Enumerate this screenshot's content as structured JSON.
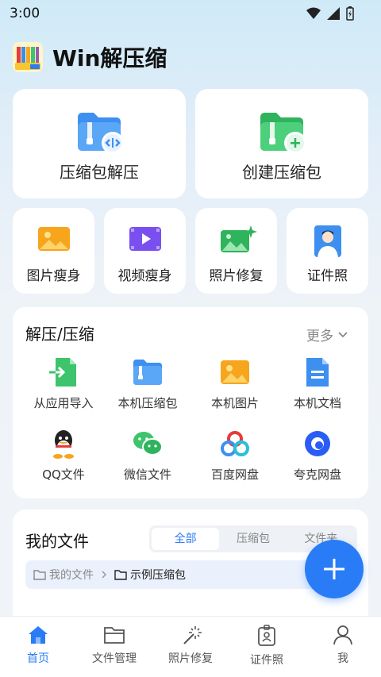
{
  "status": {
    "time": "3:00"
  },
  "app": {
    "title": "Win解压缩"
  },
  "big_cards": [
    {
      "label": "压缩包解压",
      "icon": "blue-zip-folder-icon"
    },
    {
      "label": "创建压缩包",
      "icon": "green-zip-folder-add-icon"
    }
  ],
  "small_cards": [
    {
      "label": "图片瘦身",
      "icon": "image-icon"
    },
    {
      "label": "视频瘦身",
      "icon": "video-icon"
    },
    {
      "label": "照片修复",
      "icon": "photo-sparkle-icon"
    },
    {
      "label": "证件照",
      "icon": "id-photo-icon"
    }
  ],
  "compress_section": {
    "title": "解压/压缩",
    "more": "更多",
    "items": [
      {
        "label": "从应用导入",
        "icon": "import-app-icon"
      },
      {
        "label": "本机压缩包",
        "icon": "local-zip-icon"
      },
      {
        "label": "本机图片",
        "icon": "local-image-icon"
      },
      {
        "label": "本机文档",
        "icon": "local-doc-icon"
      },
      {
        "label": "QQ文件",
        "icon": "qq-icon"
      },
      {
        "label": "微信文件",
        "icon": "wechat-icon"
      },
      {
        "label": "百度网盘",
        "icon": "baidu-netdisk-icon"
      },
      {
        "label": "夸克网盘",
        "icon": "quark-netdisk-icon"
      }
    ]
  },
  "files_section": {
    "title": "我的文件",
    "tabs": [
      "全部",
      "压缩包",
      "文件夹"
    ],
    "active_tab": "全部",
    "breadcrumb": [
      "我的文件",
      "示例压缩包"
    ]
  },
  "tabbar": [
    {
      "label": "首页",
      "icon": "home-icon",
      "active": true
    },
    {
      "label": "文件管理",
      "icon": "folder-icon",
      "active": false
    },
    {
      "label": "照片修复",
      "icon": "magic-wand-icon",
      "active": false
    },
    {
      "label": "证件照",
      "icon": "badge-icon",
      "active": false
    },
    {
      "label": "我",
      "icon": "user-icon",
      "active": false
    }
  ],
  "colors": {
    "accent": "#2a7cf6",
    "green": "#3ec46d",
    "background": "#eef3f8"
  }
}
